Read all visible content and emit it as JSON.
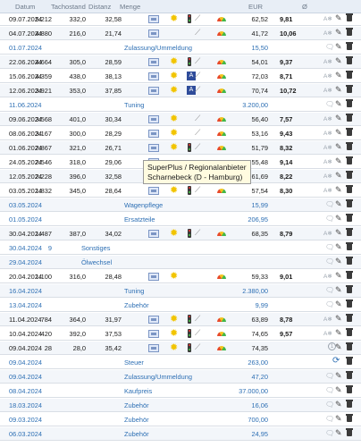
{
  "header": {
    "datum": "Datum",
    "tachostand": "Tachostand",
    "distanz": "Distanz",
    "menge": "Menge",
    "eur": "EUR",
    "avg": "Ø"
  },
  "rows": [
    {
      "date": "09.07.2024",
      "tacho": "5.212",
      "dist": "332,0",
      "menge": "32,58",
      "eur": "62,52",
      "cons": "9,81"
    },
    {
      "date": "04.07.2024",
      "tacho": "4.880",
      "dist": "216,0",
      "menge": "21,74",
      "eur": "41,72",
      "cons": "10,06"
    },
    {
      "date": "01.07.2024",
      "label": "Zulassung/Ummeldung",
      "eur": "15,50"
    },
    {
      "date": "22.06.2024",
      "tacho": "4.664",
      "dist": "305,0",
      "menge": "28,59",
      "eur": "54,01",
      "cons": "9,37"
    },
    {
      "date": "15.06.2024",
      "tacho": "4.359",
      "dist": "438,0",
      "menge": "38,13",
      "eur": "72,03",
      "cons": "8,71"
    },
    {
      "date": "12.06.2024",
      "tacho": "3.921",
      "dist": "353,0",
      "menge": "37,85",
      "eur": "70,74",
      "cons": "10,72"
    },
    {
      "date": "11.06.2024",
      "label": "Tuning",
      "eur": "3.200,00"
    },
    {
      "date": "09.06.2024",
      "tacho": "3.568",
      "dist": "401,0",
      "menge": "30,34",
      "eur": "56,40",
      "cons": "7,57"
    },
    {
      "date": "08.06.2024",
      "tacho": "3.167",
      "dist": "300,0",
      "menge": "28,29",
      "eur": "53,16",
      "cons": "9,43"
    },
    {
      "date": "01.06.2024",
      "tacho": "2.867",
      "dist": "321,0",
      "menge": "26,71",
      "eur": "51,79",
      "cons": "8,32"
    },
    {
      "date": "24.05.2024",
      "tacho": "2.546",
      "dist": "318,0",
      "menge": "29,06",
      "eur": "55,48",
      "cons": "9,14"
    },
    {
      "date": "12.05.2024",
      "tacho": "2.228",
      "dist": "396,0",
      "menge": "32,58",
      "eur": "61,69",
      "cons": "8,22"
    },
    {
      "date": "03.05.2024",
      "tacho": "1.832",
      "dist": "345,0",
      "menge": "28,64",
      "eur": "57,54",
      "cons": "8,30"
    },
    {
      "date": "03.05.2024",
      "label": "Wagenpflege",
      "eur": "15,99"
    },
    {
      "date": "01.05.2024",
      "label": "Ersatzteile",
      "eur": "206,95"
    },
    {
      "date": "30.04.2024",
      "tacho": "1.487",
      "dist": "387,0",
      "menge": "34,02",
      "eur": "68,35",
      "cons": "8,79"
    },
    {
      "date": "30.04.2024",
      "tachoNote": "9",
      "labelLeft": "Sonstiges"
    },
    {
      "date": "29.04.2024",
      "labelLeft": "Ölwechsel"
    },
    {
      "date": "20.04.2024",
      "tacho": "1.100",
      "dist": "316,0",
      "menge": "28,48",
      "eur": "59,33",
      "cons": "9,01"
    },
    {
      "date": "16.04.2024",
      "label": "Tuning",
      "eur": "2.380,00"
    },
    {
      "date": "13.04.2024",
      "label": "Zubehör",
      "eur": "9,99"
    },
    {
      "date": "11.04.2024",
      "tacho": "784",
      "dist": "364,0",
      "menge": "31,97",
      "eur": "63,89",
      "cons": "8,78"
    },
    {
      "date": "10.04.2024",
      "tacho": "420",
      "dist": "392,0",
      "menge": "37,53",
      "eur": "74,65",
      "cons": "9,57"
    },
    {
      "date": "09.04.2024",
      "tacho": "28",
      "dist": "28,0",
      "menge": "35,42",
      "eur": "74,35"
    },
    {
      "date": "09.04.2024",
      "label": "Steuer",
      "eur": "263,00"
    },
    {
      "date": "09.04.2024",
      "label": "Zulassung/Ummeldung",
      "eur": "47,20"
    },
    {
      "date": "08.04.2024",
      "label": "Kaufpreis",
      "eur": "37.000,00"
    },
    {
      "date": "18.03.2024",
      "label": "Zubehör",
      "eur": "16,06"
    },
    {
      "date": "09.03.2024",
      "label": "Zubehör",
      "eur": "700,00"
    },
    {
      "date": "06.03.2024",
      "label": "Zubehör",
      "eur": "24,95"
    }
  ],
  "tooltip": {
    "line1": "SuperPlus / Regionalanbieter",
    "line2": "Scharnebeck (D - Hamburg)"
  },
  "icons": {
    "fuel": "fuel-pump-icon",
    "sun": "sun-icon",
    "motorway": "motorway-icon",
    "traffic": "traffic-light-icon",
    "road": "road-icon",
    "gauge": "eco-gauge-icon",
    "ac": "air-condition-icon",
    "comment": "comment-icon",
    "edit": "pencil-icon",
    "delete": "trash-icon",
    "sync": "sync-icon",
    "info": "info-icon"
  }
}
